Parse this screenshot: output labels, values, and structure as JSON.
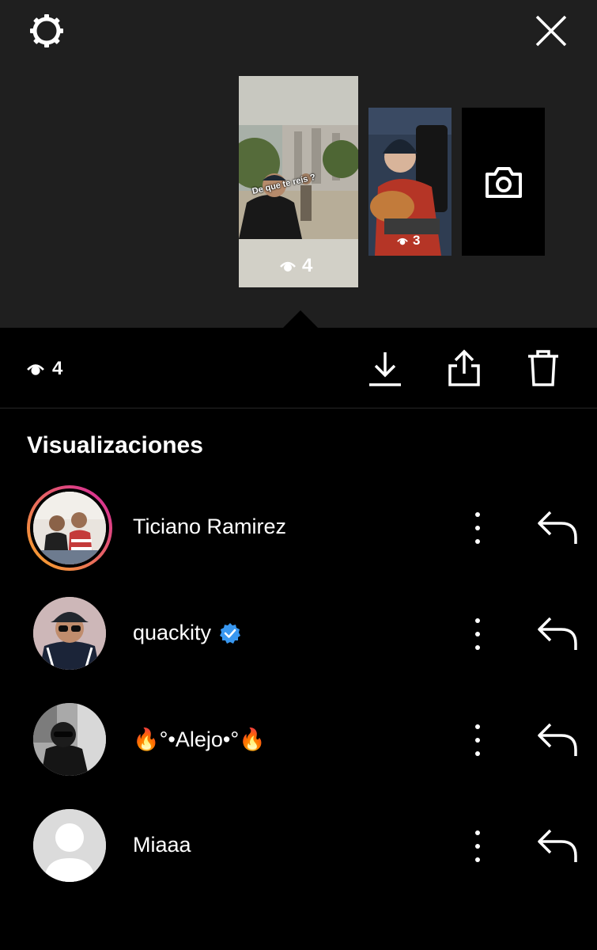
{
  "header": {
    "settings_icon": "gear-icon",
    "close_icon": "close-icon"
  },
  "story_thumbnails": [
    {
      "caption": "De que te reís ?",
      "views": "4",
      "selected": true
    },
    {
      "views": "3",
      "selected": false
    },
    {
      "type": "camera",
      "icon": "camera-icon"
    }
  ],
  "action_bar": {
    "views_count": "4",
    "download_icon": "download-icon",
    "share_icon": "share-icon",
    "delete_icon": "trash-icon"
  },
  "viewers_section": {
    "title": "Visualizaciones",
    "viewers": [
      {
        "name": "Ticiano Ramirez",
        "has_story_ring": true,
        "verified": false
      },
      {
        "name": "quackity",
        "has_story_ring": false,
        "verified": true
      },
      {
        "name": "🔥°•Alejo•°🔥",
        "has_story_ring": false,
        "verified": false
      },
      {
        "name": "Miaaa",
        "has_story_ring": false,
        "verified": false,
        "default_avatar": true
      }
    ]
  },
  "colors": {
    "top_background": "#1f1f1f",
    "background": "#000000",
    "verified_blue": "#3897f0",
    "ring_start": "#f9a825",
    "ring_end": "#d6249f"
  }
}
